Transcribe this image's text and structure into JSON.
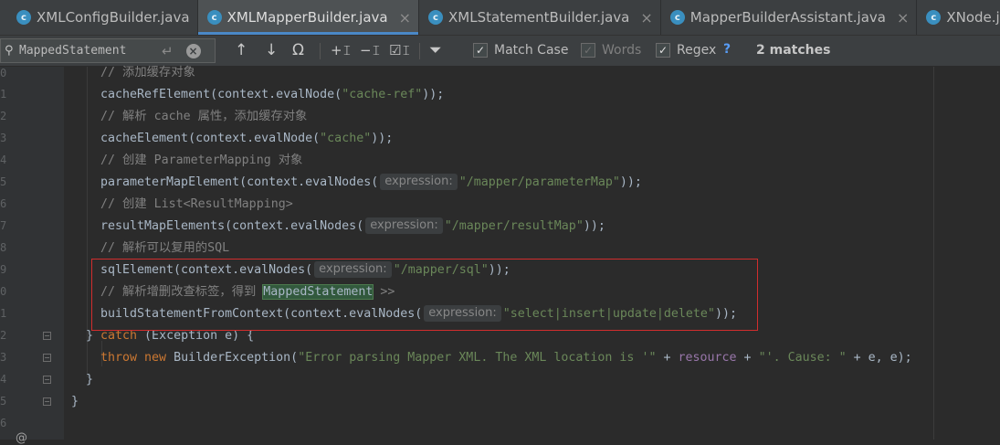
{
  "tabs": [
    {
      "icon": "class-icon",
      "icon_letter": "c",
      "label": "XMLConfigBuilder.java",
      "active": false,
      "closable": false
    },
    {
      "icon": "class-icon",
      "icon_letter": "c",
      "label": "XMLMapperBuilder.java",
      "active": true,
      "closable": true
    },
    {
      "icon": "class-icon",
      "icon_letter": "c",
      "label": "XMLStatementBuilder.java",
      "active": false,
      "closable": true
    },
    {
      "icon": "class-icon",
      "icon_letter": "c",
      "label": "MapperBuilderAssistant.java",
      "active": false,
      "closable": true
    },
    {
      "icon": "class-icon",
      "icon_letter": "c",
      "label": "XNode.jav",
      "active": false,
      "closable": false
    }
  ],
  "close_glyph": "×",
  "find": {
    "query": "MappedStatement",
    "search_glyph": "⚲",
    "newline_glyph": "↵",
    "clear_glyph": "×",
    "buttons": {
      "prev": "↑",
      "next": "↓",
      "find_in_file": "Ω",
      "add_occurrence": "+𝙸",
      "remove_occurrence": "−𝙸",
      "select_all": "☑𝙸",
      "filter": "⏷"
    },
    "options": [
      {
        "label": "Match Case",
        "checked": true,
        "disabled": false
      },
      {
        "label": "Words",
        "checked": true,
        "disabled": true
      },
      {
        "label": "Regex",
        "checked": true,
        "disabled": false
      }
    ],
    "check_glyph": "✓",
    "help": "?",
    "matches": "2 matches"
  },
  "gutter": {
    "line_numbers": [
      "0",
      "1",
      "2",
      "3",
      "4",
      "5",
      "6",
      "7",
      "8",
      "9",
      "0",
      "1",
      "2",
      "3",
      "4",
      "5",
      "6",
      "7"
    ],
    "fold_glyph": "−",
    "bottom_icon": "@"
  },
  "code": {
    "l0_comment": "// 添加缓存对象",
    "l1_code": "cacheRefElement(context.evalNode(",
    "l1_str": "\"cache-ref\"",
    "l1_end": "));",
    "l2_comment": "// 解析 cache 属性，添加缓存对象",
    "l3_code": "cacheElement(context.evalNode(",
    "l3_str": "\"cache\"",
    "l3_end": "));",
    "l4_comment": "// 创建 ParameterMapping 对象",
    "l5_code": "parameterMapElement(context.evalNodes(",
    "l5_hint": "expression:",
    "l5_str": "\"/mapper/parameterMap\"",
    "l5_end": "));",
    "l6_comment": "// 创建 List<ResultMapping>",
    "l7_code": "resultMapElements(context.evalNodes(",
    "l7_hint": "expression:",
    "l7_str": "\"/mapper/resultMap\"",
    "l7_end": "));",
    "l8_comment": "// 解析可以复用的SQL",
    "l9_code": "sqlElement(context.evalNodes(",
    "l9_hint": "expression:",
    "l9_str": "\"/mapper/sql\"",
    "l9_end": "));",
    "l10_comment_pre": "// 解析增删改查标签，得到 ",
    "l10_match": "MappedStatement",
    "l10_comment_post": " >>",
    "l11_code": "buildStatementFromContext(context.evalNodes(",
    "l11_hint": "expression:",
    "l11_str": "\"select|insert|update|delete\"",
    "l11_end": "));",
    "l12_brace": "} ",
    "l12_kw": "catch",
    "l12_rest": " (Exception e) {",
    "l13_kw1": "throw",
    "l13_kw2": "new",
    "l13_code": " BuilderException(",
    "l13_str1": "\"Error parsing Mapper XML. The XML location is '\"",
    "l13_plus1": " + ",
    "l13_field": "resource",
    "l13_plus2": " + ",
    "l13_str2": "\"'. Cause: \"",
    "l13_end": " + e, e);",
    "l14_brace": "}",
    "l15_brace": "}"
  }
}
